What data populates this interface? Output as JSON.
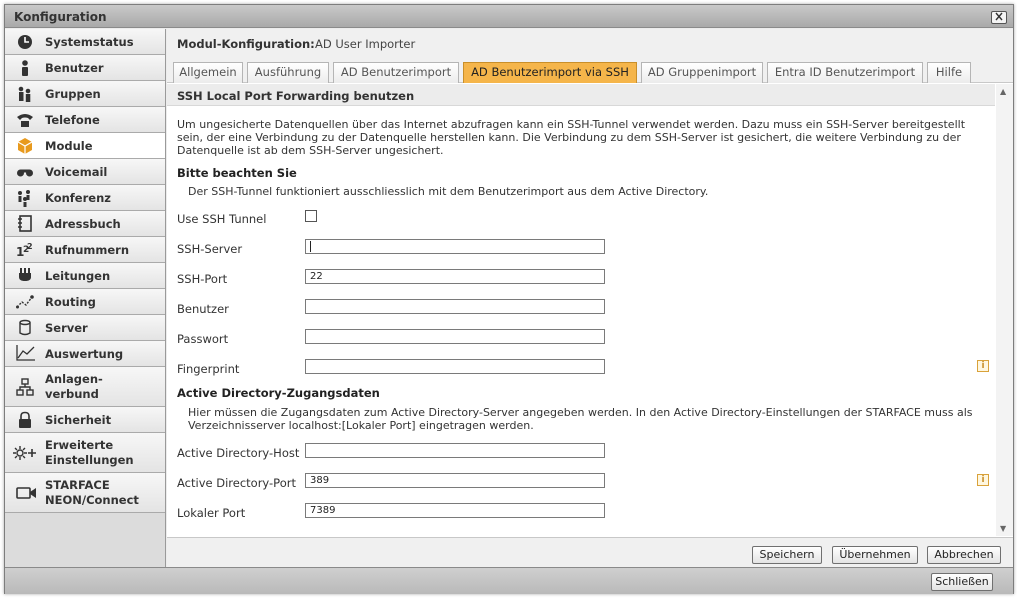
{
  "window": {
    "title": "Konfiguration"
  },
  "sidebar": {
    "items": [
      {
        "label": "Systemstatus",
        "icon": "clock-icon"
      },
      {
        "label": "Benutzer",
        "icon": "user-icon"
      },
      {
        "label": "Gruppen",
        "icon": "group-icon"
      },
      {
        "label": "Telefone",
        "icon": "phone-icon"
      },
      {
        "label": "Module",
        "icon": "cube-icon",
        "active": true
      },
      {
        "label": "Voicemail",
        "icon": "voicemail-icon"
      },
      {
        "label": "Konferenz",
        "icon": "conference-icon"
      },
      {
        "label": "Adressbuch",
        "icon": "addressbook-icon"
      },
      {
        "label": "Rufnummern",
        "icon": "numbers-icon"
      },
      {
        "label": "Leitungen",
        "icon": "plug-icon"
      },
      {
        "label": "Routing",
        "icon": "routing-icon"
      },
      {
        "label": "Server",
        "icon": "server-icon"
      },
      {
        "label": "Auswertung",
        "icon": "chart-icon"
      },
      {
        "label_line1": "Anlagen-",
        "label_line2": "verbund",
        "icon": "network-icon"
      },
      {
        "label": "Sicherheit",
        "icon": "lock-icon"
      },
      {
        "label_line1": "Erweiterte",
        "label_line2": "Einstellungen",
        "icon": "settings-icon"
      },
      {
        "label_line1": "STARFACE",
        "label_line2": "NEON/Connect",
        "icon": "camera-icon"
      }
    ]
  },
  "module": {
    "header_label": "Modul-Konfiguration:",
    "header_value": "AD User Importer"
  },
  "tabs": [
    {
      "label": "Allgemein"
    },
    {
      "label": "Ausführung"
    },
    {
      "label": "AD Benutzerimport"
    },
    {
      "label": "AD Benutzerimport via SSH",
      "active": true
    },
    {
      "label": "AD Gruppenimport"
    },
    {
      "label": "Entra ID Benutzerimport"
    },
    {
      "label": "Hilfe"
    }
  ],
  "section": {
    "title": "SSH Local Port Forwarding benutzen",
    "intro_line1": "Um ungesicherte Datenquellen über das Internet abzufragen kann ein SSH-Tunnel verwendet werden. Dazu muss ein SSH-Server bereitgestellt",
    "intro_line2": "sein, der eine Verbindung zu der Datenquelle herstellen kann. Die Verbindung zu dem SSH-Server ist gesichert, die weitere Verbindung zu der",
    "intro_line3": "Datenquelle ist ab dem SSH-Server ungesichert.",
    "note_title": "Bitte beachten Sie",
    "note_text": "Der SSH-Tunnel funktioniert ausschliesslich mit dem Benutzerimport aus dem Active Directory."
  },
  "form": {
    "use_ssh_label": "Use SSH Tunnel",
    "use_ssh_checked": false,
    "ssh_server_label": "SSH-Server",
    "ssh_server_value": "",
    "ssh_port_label": "SSH-Port",
    "ssh_port_value": "22",
    "user_label": "Benutzer",
    "user_value": "",
    "password_label": "Passwort",
    "password_value": "",
    "fingerprint_label": "Fingerprint",
    "fingerprint_value": ""
  },
  "ad_section": {
    "title": "Active Directory-Zugangsdaten",
    "text_line1": "Hier müssen die Zugangsdaten zum Active Directory-Server angegeben werden. In den Active Directory-Einstellungen der STARFACE muss als",
    "text_line2": "Verzeichnisserver localhost:[Lokaler Port] eingetragen werden.",
    "host_label": "Active Directory-Host",
    "host_value": "",
    "port_label": "Active Directory-Port",
    "port_value": "389",
    "local_port_label": "Lokaler Port",
    "local_port_value": "7389"
  },
  "info_icon_glyph": "i",
  "buttons": {
    "save": "Speichern",
    "apply": "Übernehmen",
    "cancel": "Abbrechen",
    "close": "Schließen"
  },
  "colors": {
    "active_tab": "#f5b54a",
    "accent_orange": "#e89a1e"
  }
}
